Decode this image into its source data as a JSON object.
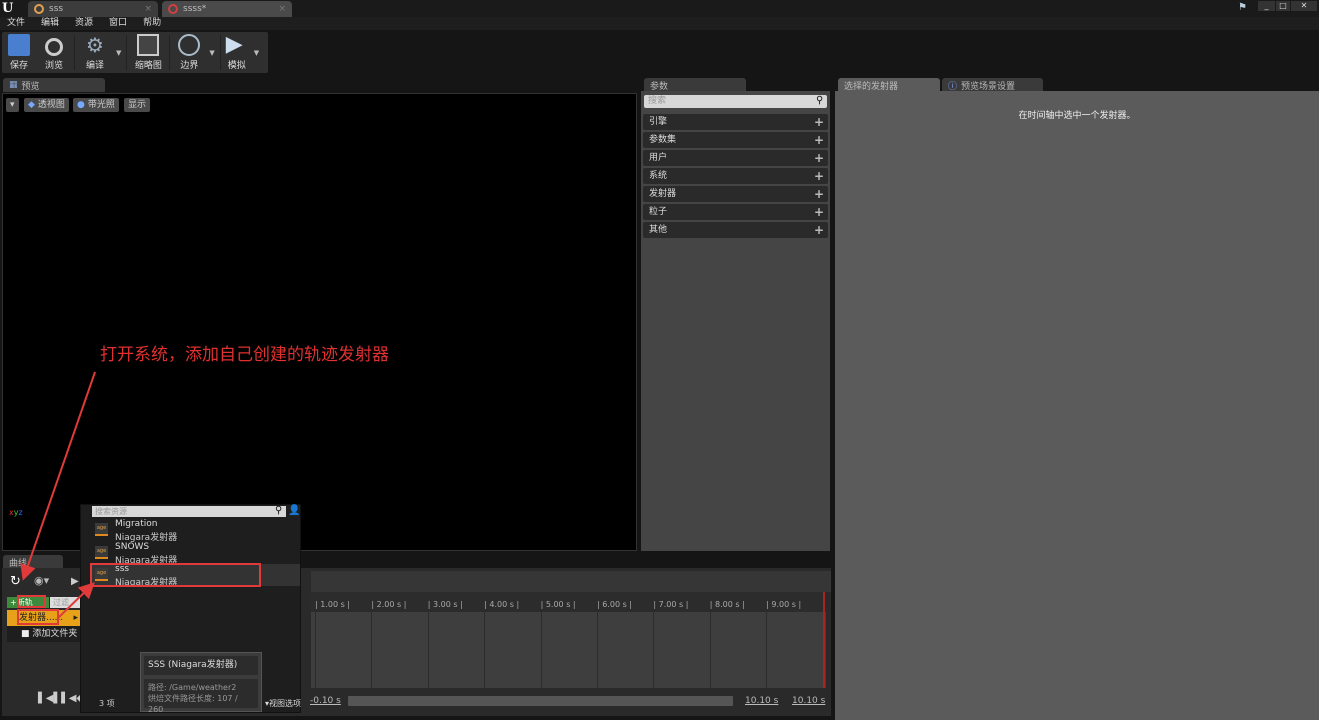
{
  "doc_tabs": [
    {
      "label": "sss"
    },
    {
      "label": "ssss*"
    }
  ],
  "window_controls": {
    "minimize": "_",
    "maximize": "□",
    "close": "✕"
  },
  "menu": [
    "文件",
    "编辑",
    "资源",
    "窗口",
    "帮助"
  ],
  "toolbar": {
    "save": "保存",
    "browse": "浏览",
    "compile": "编译",
    "thumbnail": "缩略图",
    "bounds": "边界",
    "simulate": "模拟"
  },
  "preview": {
    "tab": "预览",
    "perspective": "透视图",
    "lit": "带光照",
    "show": "显示"
  },
  "params": {
    "tab": "参数",
    "search_placeholder": "搜索",
    "categories": [
      "引擎",
      "参数集",
      "用户",
      "系统",
      "发射器",
      "粒子",
      "其他"
    ]
  },
  "right": {
    "tabs": [
      "选择的发射器",
      "预览场景设置"
    ],
    "message": "在时间轴中选中一个发射器。"
  },
  "curves": {
    "tab": "曲线",
    "track_button": "+新轨",
    "filter": "过滤",
    "emitter_item": "发射器......",
    "add_folder": "添加文件夹"
  },
  "timeline": {
    "ticks": [
      "1.00 s",
      "2.00 s",
      "3.00 s",
      "4.00 s",
      "5.00 s",
      "6.00 s",
      "7.00 s",
      "8.00 s",
      "9.00 s"
    ],
    "start": "-0.10 s",
    "end1": "10.10 s",
    "end2": "10.10 s"
  },
  "asset_picker": {
    "search_placeholder": "搜索资源",
    "items": [
      {
        "name": "Migration",
        "type": "Niagara发射器"
      },
      {
        "name": "SNOWS",
        "type": "Niagara发射器"
      },
      {
        "name": "sss",
        "type": "Niagara发射器"
      }
    ],
    "count": "3 项",
    "view_options": "视图选项"
  },
  "tooltip": {
    "title": "SSS (Niagara发射器)",
    "path": "路径: /Game/weather2",
    "path_length": "烘焙文件路径长度: 107 / 260"
  },
  "annotation": "打开系统，添加自己创建的轨迹发射器",
  "colors": {
    "annotation": "#e03030",
    "accent_orange": "#e8a21a",
    "track_green": "#3d8a3d"
  }
}
